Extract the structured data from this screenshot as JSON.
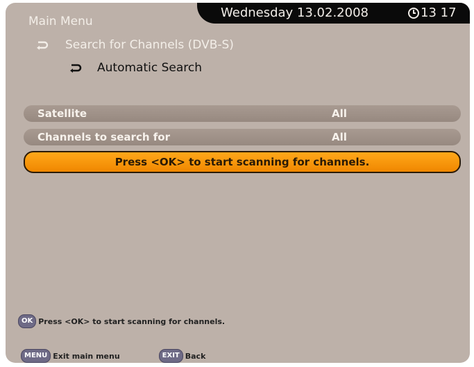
{
  "header": {
    "menu_title": "Main Menu",
    "date": "Wednesday 13.02.2008",
    "time": "13 17"
  },
  "breadcrumb": {
    "level1": "Search for Channels (DVB-S)",
    "level2": "Automatic Search"
  },
  "settings": [
    {
      "label": "Satellite",
      "value": "All"
    },
    {
      "label": "Channels to search for",
      "value": "All"
    }
  ],
  "action": {
    "label": "Press <OK> to start scanning for channels."
  },
  "hint": {
    "key": "OK",
    "text": "Press <OK> to start scanning for channels."
  },
  "footer": {
    "menu_key": "MENU",
    "menu_label": "Exit main menu",
    "exit_key": "EXIT",
    "exit_label": "Back"
  },
  "colors": {
    "background": "#bdb1a9",
    "highlight": "#f39a0c",
    "header_strip": "#0a0a0a"
  }
}
